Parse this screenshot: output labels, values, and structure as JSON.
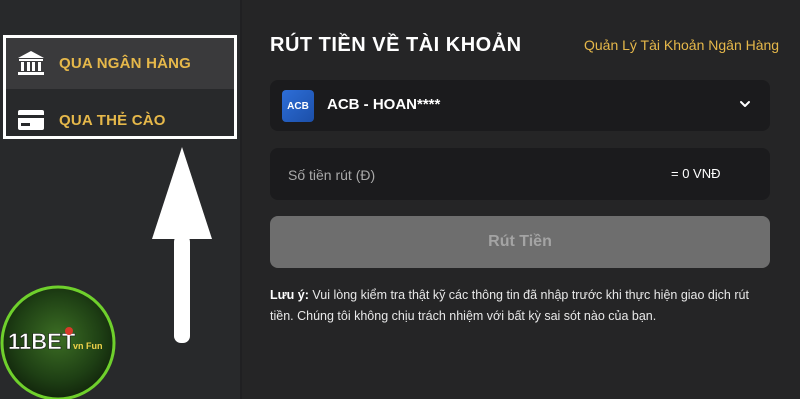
{
  "sidebar": {
    "items": [
      {
        "label": "QUA NGÂN HÀNG",
        "icon": "bank-icon",
        "active": true
      },
      {
        "label": "QUA THẺ CÀO",
        "icon": "card-icon",
        "active": false
      }
    ]
  },
  "logo": {
    "text": "11BET",
    "suffix": "vn Fun"
  },
  "main": {
    "title": "RÚT TIỀN VỀ TÀI KHOẢN",
    "manage_link": "Quản Lý Tài Khoản Ngân Hàng",
    "bank_select": {
      "logo_text": "ACB",
      "value": "ACB - HOAN****",
      "icon": "chevron-down-icon"
    },
    "amount": {
      "placeholder": "Số tiền rút (Đ)",
      "value": "",
      "converted": "= 0 VNĐ"
    },
    "submit_label": "Rút Tiền",
    "note": {
      "label": "Lưu ý:",
      "text": "Vui lòng kiểm tra thật kỹ các thông tin đã nhập trước khi thực hiện giao dịch rút tiền. Chúng tôi không chịu trách nhiệm với bất kỳ sai sót nào của bạn."
    }
  },
  "colors": {
    "accent": "#e6b84a",
    "background": "#252526",
    "sidebar": "#28292b",
    "input_bg": "#1b1b1d",
    "button_disabled": "#6e6e6e"
  }
}
